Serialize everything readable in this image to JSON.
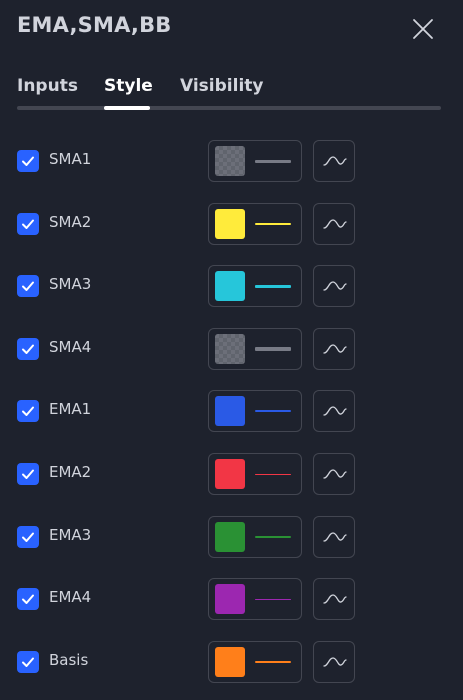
{
  "dialog": {
    "title": "EMA,SMA,BB",
    "close_icon": "close-icon"
  },
  "tabs": [
    {
      "label": "Inputs",
      "active": false
    },
    {
      "label": "Style",
      "active": true
    },
    {
      "label": "Visibility",
      "active": false
    }
  ],
  "plots": [
    {
      "label": "SMA1",
      "checked": true,
      "color": "#787b86",
      "line_thickness": 3,
      "translucent": true
    },
    {
      "label": "SMA2",
      "checked": true,
      "color": "#ffeb3b",
      "line_thickness": 2,
      "translucent": false
    },
    {
      "label": "SMA3",
      "checked": true,
      "color": "#26c6da",
      "line_thickness": 3,
      "translucent": false
    },
    {
      "label": "SMA4",
      "checked": true,
      "color": "#787b86",
      "line_thickness": 4,
      "translucent": true
    },
    {
      "label": "EMA1",
      "checked": true,
      "color": "#2a5ae6",
      "line_thickness": 2,
      "translucent": false
    },
    {
      "label": "EMA2",
      "checked": true,
      "color": "#f23645",
      "line_thickness": 1,
      "translucent": false
    },
    {
      "label": "EMA3",
      "checked": true,
      "color": "#2a9134",
      "line_thickness": 2,
      "translucent": false
    },
    {
      "label": "EMA4",
      "checked": true,
      "color": "#9c27b0",
      "line_thickness": 1,
      "translucent": false
    },
    {
      "label": "Basis",
      "checked": true,
      "color": "#ff7f1a",
      "line_thickness": 2,
      "translucent": false
    }
  ],
  "icons": {
    "checkbox": "checkmark-icon",
    "line_style": "line-style-icon"
  }
}
